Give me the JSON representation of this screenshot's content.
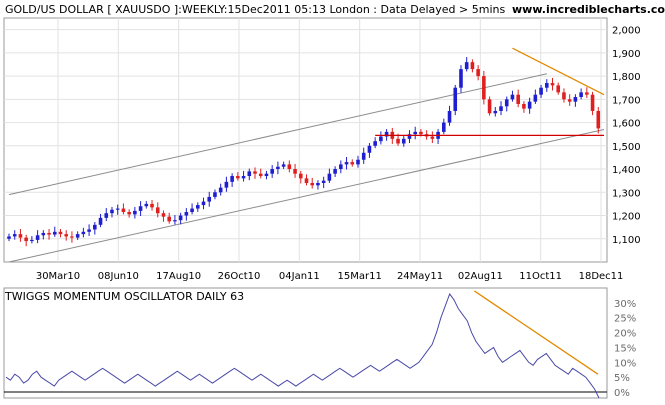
{
  "header": {
    "title": "GOLD/US DOLLAR [ XAUUSDO ]:WEEKLY:15Dec2011 05:13 London : Data Delayed > 5mins",
    "site": "www.incrediblecharts.com"
  },
  "chart_data": [
    {
      "type": "candlestick",
      "title": "GOLD/US DOLLAR [ XAUUSDO ]:WEEKLY:15Dec2011 05:13 London : Data Delayed > 5mins",
      "x_tick_labels": [
        "30Mar10",
        "08Jun10",
        "17Aug10",
        "26Oct10",
        "04Jan11",
        "15Mar11",
        "24May11",
        "02Aug11",
        "11Oct11",
        "18Dec11"
      ],
      "y_tick_labels": [
        "1,100",
        "1,200",
        "1,300",
        "1,400",
        "1,500",
        "1,600",
        "1,700",
        "1,800",
        "1,900",
        "2,000"
      ],
      "y_ticks": [
        1100,
        1200,
        1300,
        1400,
        1500,
        1600,
        1700,
        1800,
        1900,
        2000
      ],
      "ylim": [
        1000,
        2050
      ],
      "grid": true,
      "colors": {
        "up": "#1f1fd0",
        "down": "#e02020",
        "channel": "#8c8c8c",
        "support": "#d00000",
        "resistance": "#e08a00"
      },
      "closes": [
        1110,
        1120,
        1105,
        1090,
        1095,
        1115,
        1125,
        1118,
        1130,
        1120,
        1110,
        1105,
        1120,
        1130,
        1140,
        1160,
        1190,
        1210,
        1225,
        1230,
        1215,
        1205,
        1220,
        1240,
        1250,
        1235,
        1210,
        1195,
        1175,
        1180,
        1200,
        1215,
        1230,
        1245,
        1260,
        1280,
        1300,
        1320,
        1345,
        1370,
        1360,
        1370,
        1390,
        1380,
        1370,
        1380,
        1400,
        1410,
        1420,
        1400,
        1380,
        1360,
        1340,
        1330,
        1340,
        1350,
        1380,
        1400,
        1420,
        1430,
        1420,
        1440,
        1470,
        1500,
        1520,
        1540,
        1560,
        1530,
        1510,
        1530,
        1550,
        1560,
        1550,
        1540,
        1530,
        1560,
        1600,
        1650,
        1750,
        1830,
        1860,
        1830,
        1800,
        1700,
        1640,
        1650,
        1670,
        1700,
        1720,
        1680,
        1660,
        1690,
        1720,
        1750,
        1770,
        1760,
        1730,
        1700,
        1690,
        1710,
        1730,
        1720,
        1650,
        1575
      ],
      "channel": {
        "upper": [
          [
            0,
            1290
          ],
          [
            94,
            1810
          ]
        ],
        "lower": [
          [
            0,
            1000
          ],
          [
            104,
            1570
          ]
        ]
      },
      "support": {
        "y": 1545,
        "from": 64,
        "to": 104
      },
      "resistance": [
        [
          88,
          1920
        ],
        [
          104,
          1720
        ]
      ]
    },
    {
      "type": "line",
      "title": "TWIGGS MOMENTUM OSCILLATOR DAILY 63",
      "y_tick_labels": [
        "0%",
        "5%",
        "10%",
        "15%",
        "20%",
        "25%",
        "30%"
      ],
      "y_ticks": [
        0,
        5,
        10,
        15,
        20,
        25,
        30
      ],
      "ylim": [
        -2,
        35
      ],
      "zero_line": 0,
      "colors": {
        "line": "#4a4aa8",
        "trend": "#e08a00",
        "zero": "#000000"
      },
      "trend": [
        [
          0.78,
          34
        ],
        [
          0.985,
          6
        ]
      ],
      "values": [
        5,
        4,
        6,
        5,
        3,
        4,
        6,
        7,
        5,
        4,
        3,
        2,
        4,
        5,
        6,
        7,
        6,
        5,
        4,
        5,
        6,
        7,
        8,
        7,
        6,
        5,
        4,
        3,
        4,
        5,
        6,
        5,
        4,
        3,
        2,
        3,
        4,
        5,
        6,
        7,
        6,
        5,
        4,
        5,
        6,
        5,
        4,
        3,
        4,
        5,
        6,
        7,
        8,
        7,
        6,
        5,
        4,
        5,
        6,
        5,
        4,
        3,
        2,
        3,
        4,
        3,
        2,
        3,
        4,
        5,
        6,
        5,
        4,
        5,
        6,
        7,
        8,
        7,
        6,
        5,
        6,
        7,
        8,
        9,
        8,
        7,
        8,
        9,
        10,
        11,
        10,
        9,
        8,
        9,
        10,
        12,
        14,
        16,
        20,
        25,
        29,
        33,
        31,
        28,
        26,
        24,
        20,
        17,
        15,
        13,
        14,
        15,
        12,
        10,
        11,
        12,
        13,
        14,
        12,
        10,
        9,
        11,
        12,
        13,
        11,
        9,
        8,
        7,
        6,
        8,
        7,
        6,
        5,
        3,
        1,
        -2
      ]
    }
  ]
}
